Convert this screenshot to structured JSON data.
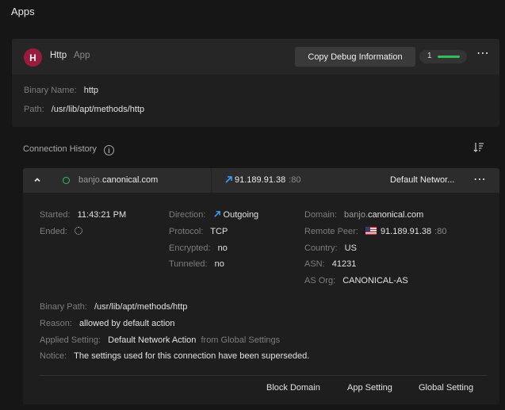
{
  "page": {
    "title": "Apps"
  },
  "app": {
    "avatar_letter": "H",
    "avatar_color": "#9b1b3c",
    "name": "Http",
    "type_label": "App",
    "copy_button": "Copy Debug Information",
    "connection_count": "1",
    "count_bar_color": "#2fbf5a",
    "binary_name_label": "Binary Name:",
    "binary_name": "http",
    "path_label": "Path:",
    "path": "/usr/lib/apt/methods/http"
  },
  "history": {
    "title": "Connection History",
    "info_icon": "info-circle-icon",
    "sort_icon": "sort-descending-icon"
  },
  "connection": {
    "domain_sub": "banjo.",
    "domain_main": "canonical.com",
    "ip": "91.189.91.38",
    "port": ":80",
    "network_action": "Default Networ...",
    "status_color": "#2fbf5a",
    "started_label": "Started:",
    "started": "11:43:21 PM",
    "ended_label": "Ended:",
    "direction_label": "Direction:",
    "direction": "Outgoing",
    "protocol_label": "Protocol:",
    "protocol": "TCP",
    "encrypted_label": "Encrypted:",
    "encrypted": "no",
    "tunneled_label": "Tunneled:",
    "tunneled": "no",
    "domain_label": "Domain:",
    "domain_detail_sub": "banjo.",
    "domain_detail_main": "canonical.com",
    "remote_peer_label": "Remote Peer:",
    "remote_peer_ip": "91.189.91.38",
    "remote_peer_port": ":80",
    "country_label": "Country:",
    "country": "US",
    "asn_label": "ASN:",
    "asn": "41231",
    "as_org_label": "AS Org:",
    "as_org": "CANONICAL-AS",
    "binary_path_label": "Binary Path:",
    "binary_path": "/usr/lib/apt/methods/http",
    "reason_label": "Reason:",
    "reason": "allowed by default action",
    "applied_setting_label": "Applied Setting:",
    "applied_setting": "Default Network Action",
    "applied_setting_source": "from Global Settings",
    "notice_label": "Notice:",
    "notice": "The settings used for this connection have been superseded.",
    "actions": [
      "Block Domain",
      "App Setting",
      "Global Setting"
    ]
  }
}
